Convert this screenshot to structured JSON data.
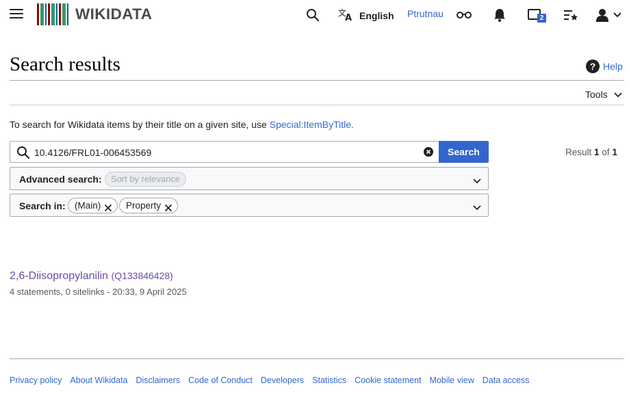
{
  "header": {
    "menu_icon": "hamburger-menu-icon",
    "logo_text": "WIKIDATA",
    "logo_bar_colors": [
      "#990000",
      "#339966",
      "#006699",
      "#990000",
      "#339966",
      "#006699",
      "#990000",
      "#339966",
      "#006699"
    ],
    "search_icon": "search-icon",
    "language_icon": "translate-icon",
    "language_label": "English",
    "username": "Ptrutnau",
    "watchlist_icon": "glasses-icon",
    "notifications_icon": "bell-icon",
    "messages_icon": "tray-icon",
    "messages_count": "2",
    "watchlist_star_icon": "list-star-icon",
    "user_icon": "user-icon",
    "user_chevron_icon": "chevron-down-icon"
  },
  "page": {
    "title": "Search results",
    "help_label": "Help",
    "tools_label": "Tools"
  },
  "intro": {
    "text": "To search for Wikidata items by their title on a given site, use ",
    "link": "Special:ItemByTitle",
    "suffix": "."
  },
  "search": {
    "value": "10.4126/FRL01-006453569",
    "button_label": "Search",
    "result_prefix": "Result ",
    "result_current": "1",
    "result_of": " of ",
    "result_total": "1"
  },
  "advanced": {
    "label": "Advanced search:",
    "sort_chip": "Sort by relevance"
  },
  "search_in": {
    "label": "Search in:",
    "chips": [
      "(Main)",
      "Property"
    ]
  },
  "results": [
    {
      "title": "2,6-Diisopropylanilin",
      "id": "(Q133846428)",
      "meta": "4 statements, 0 sitelinks - 20:33, 9 April 2025"
    }
  ],
  "footer": {
    "links": [
      "Privacy policy",
      "About Wikidata",
      "Disclaimers",
      "Code of Conduct",
      "Developers",
      "Statistics",
      "Cookie statement",
      "Mobile view",
      "Data access"
    ]
  },
  "colors": {
    "link": "#3366cc",
    "visited": "#6b4ba1",
    "accent_button": "#3366cc"
  }
}
